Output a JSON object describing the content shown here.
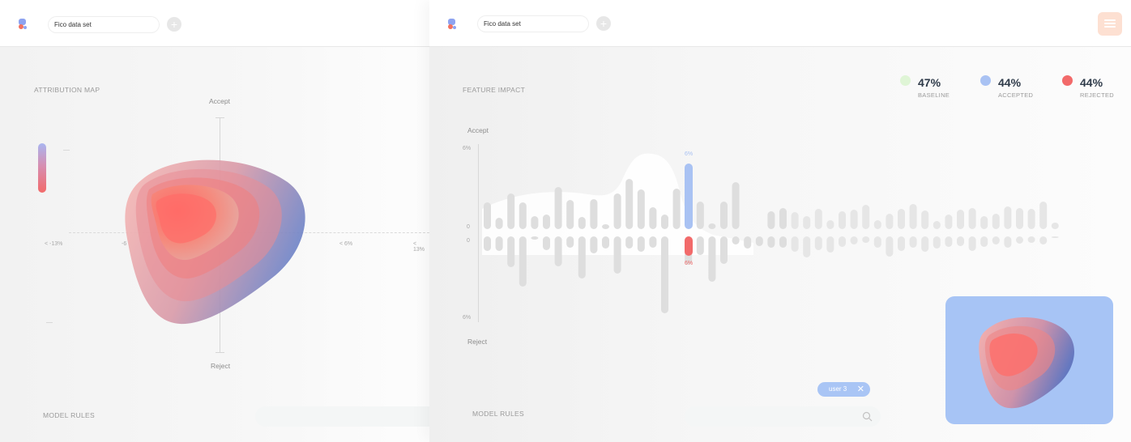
{
  "left_panel": {
    "dataset_name": "Fico data set",
    "section_title": "ATTRIBUTION MAP",
    "axis_top": "Accept",
    "axis_bottom": "Reject",
    "x_ticks": [
      "< -13%",
      "-6",
      "< 6%",
      "< 13%"
    ],
    "footer_title": "MODEL RULES",
    "colors": {
      "accept": "#a9c0f2",
      "reject": "#f26a6a",
      "blob_blue": "#7a8ccb",
      "blob_red": "#ff6f6a"
    }
  },
  "right_panel": {
    "dataset_name": "Fico data set",
    "section_title": "FEATURE IMPACT",
    "axis_top": "Accept",
    "axis_bottom": "Reject",
    "y_ticks": {
      "top": "6%",
      "zero_upper": "0",
      "zero_lower": "0",
      "bottom": "6%"
    },
    "highlight": {
      "accept_label": "6%",
      "reject_label": "6%",
      "accept_color": "#a9c2f3",
      "reject_color": "#f26a6a"
    },
    "stats": [
      {
        "value": "47%",
        "label": "BASELINE",
        "color": "#dff5d6"
      },
      {
        "value": "44%",
        "label": "ACCEPTED",
        "color": "#a9c2f3"
      },
      {
        "value": "44%",
        "label": "REJECTED",
        "color": "#f26a6a"
      }
    ],
    "filter_chip": {
      "label": "user 3",
      "close_glyph": "✕"
    },
    "footer_title": "MODEL RULES",
    "icons": {
      "menu": "hamburger-menu-icon",
      "search": "search-icon",
      "add": "plus-icon",
      "logo": "app-logo-icon"
    }
  }
}
